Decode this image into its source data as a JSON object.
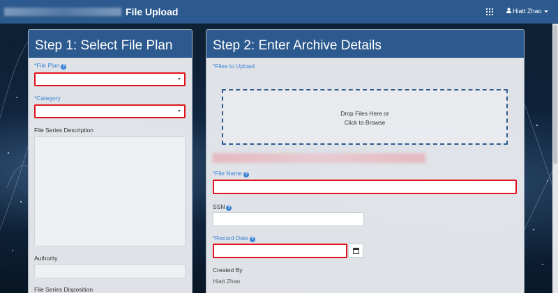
{
  "header": {
    "title": "File Upload",
    "apps_icon": "grid-icon",
    "user_name": "Hiatt Zhao",
    "user_icon": "user-icon"
  },
  "step1": {
    "title": "Step 1: Select File Plan",
    "file_plan_label": "*File Plan",
    "file_plan_value": "",
    "category_label": "*Category",
    "category_value": "",
    "series_description_label": "File Series Description",
    "series_description_value": "",
    "authority_label": "Authority",
    "authority_value": "",
    "disposition_label": "File Series Disposition"
  },
  "step2": {
    "title": "Step 2: Enter Archive Details",
    "files_label": "*Files to Upload",
    "dropzone_line1": "Drop Files Here or",
    "dropzone_line2": "Click to Browse",
    "file_name_label": "*File Name",
    "file_name_value": "",
    "ssn_label": "SSN",
    "ssn_value": "",
    "record_date_label": "*Record Date",
    "record_date_value": "",
    "calendar_icon": "calendar-icon",
    "created_by_label": "Created By",
    "created_by_value": "Hiatt Zhao"
  },
  "colors": {
    "header_blue": "#2d5a8e",
    "required_label_blue": "#3b82d6",
    "error_red": "#e0141e"
  }
}
